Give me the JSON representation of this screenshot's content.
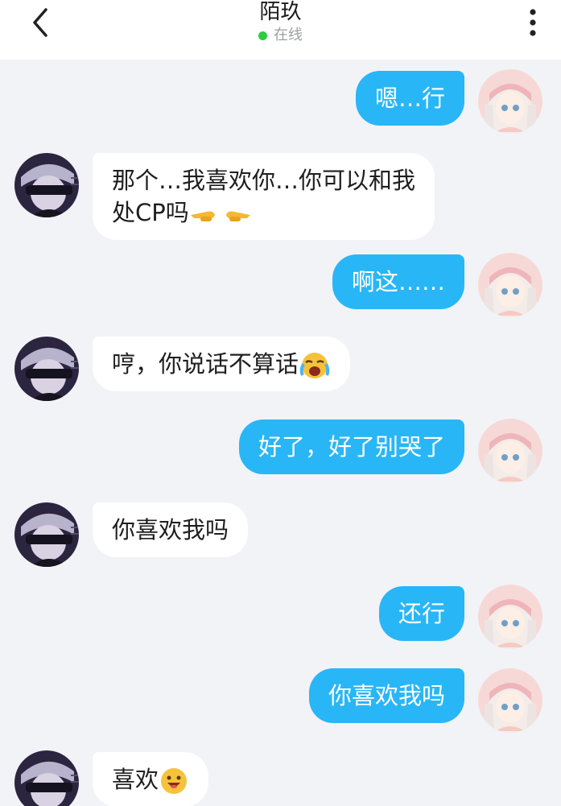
{
  "header": {
    "title": "陌玖",
    "status": "在线",
    "back_icon": "chevron-left-icon",
    "more_icon": "more-vertical-icon"
  },
  "colors": {
    "header_bg": "#ffffff",
    "chat_bg": "#f2f3f7",
    "outgoing_bubble": "#29b6f6",
    "incoming_bubble": "#ffffff",
    "online_dot": "#2ecc40"
  },
  "messages": [
    {
      "direction": "out",
      "text": "嗯…行"
    },
    {
      "direction": "in",
      "line1": "那个…我喜欢你…你可以和我",
      "line2": "处CP吗",
      "emoji": "pointing-fingers-emoji"
    },
    {
      "direction": "out",
      "text": "啊这……"
    },
    {
      "direction": "in",
      "text": "哼，你说话不算话",
      "emoji": "crying-face-emoji"
    },
    {
      "direction": "out",
      "text": "好了，好了别哭了"
    },
    {
      "direction": "in",
      "text": "你喜欢我吗"
    },
    {
      "direction": "out",
      "text": "还行"
    },
    {
      "direction": "out",
      "text": "你喜欢我吗"
    },
    {
      "direction": "in",
      "text": "喜欢",
      "emoji": "smiling-face-emoji"
    }
  ]
}
